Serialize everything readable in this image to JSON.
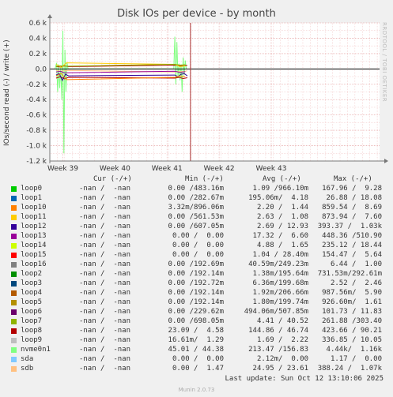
{
  "title": "Disk IOs per device - by month",
  "watermark": "RRDTOOL / TOBI OETIKER",
  "footer": {
    "last_update": "Last update: Sun Oct 12 13:10:06 2025",
    "version": "Munin 2.0.73"
  },
  "legend_headers": {
    "cur": "Cur (-/+)",
    "min": "Min (-/+)",
    "avg": "Avg (-/+)",
    "max": "Max (-/+)"
  },
  "legend_rows": [
    {
      "name": "loop0",
      "color": "#00cc00",
      "cur": "-nan /  -nan",
      "min": "0.00 /483.16m",
      "avg": "1.09 /966.10m",
      "max": "167.96 /  9.28"
    },
    {
      "name": "loop1",
      "color": "#0066b3",
      "cur": "-nan /  -nan",
      "min": "0.00 /282.67m",
      "avg": "195.06m/  4.18",
      "max": "26.88 / 18.08"
    },
    {
      "name": "loop10",
      "color": "#ff8000",
      "cur": "-nan /  -nan",
      "min": "3.32m/896.06m",
      "avg": "2.20 /  1.44",
      "max": "859.54 /  8.69"
    },
    {
      "name": "loop11",
      "color": "#ffcc00",
      "cur": "-nan /  -nan",
      "min": "0.00 /561.53m",
      "avg": "2.63 /  1.08",
      "max": "873.94 /  7.60"
    },
    {
      "name": "loop12",
      "color": "#330099",
      "cur": "-nan /  -nan",
      "min": "0.00 /607.05m",
      "avg": "2.69 / 12.93",
      "max": "393.37 /  1.03k"
    },
    {
      "name": "loop13",
      "color": "#990099",
      "cur": "-nan /  -nan",
      "min": "0.00 /  0.00",
      "avg": "17.32 /  6.60",
      "max": "448.36 /510.90"
    },
    {
      "name": "loop14",
      "color": "#ccff00",
      "cur": "-nan /  -nan",
      "min": "0.00 /  0.00",
      "avg": "4.88 /  1.65",
      "max": "235.12 / 18.44"
    },
    {
      "name": "loop15",
      "color": "#ff0000",
      "cur": "-nan /  -nan",
      "min": "0.00 /  0.00",
      "avg": "1.04 / 28.40m",
      "max": "154.47 /  5.64"
    },
    {
      "name": "loop16",
      "color": "#808080",
      "cur": "-nan /  -nan",
      "min": "0.00 /192.69m",
      "avg": "40.59m/249.23m",
      "max": "6.44 /  1.00"
    },
    {
      "name": "loop2",
      "color": "#008f00",
      "cur": "-nan /  -nan",
      "min": "0.00 /192.14m",
      "avg": "1.38m/195.64m",
      "max": "731.53m/292.61m"
    },
    {
      "name": "loop3",
      "color": "#00487d",
      "cur": "-nan /  -nan",
      "min": "0.00 /192.72m",
      "avg": "6.36m/199.68m",
      "max": "2.52 /  2.46"
    },
    {
      "name": "loop4",
      "color": "#b35a00",
      "cur": "-nan /  -nan",
      "min": "0.00 /192.14m",
      "avg": "1.92m/206.66m",
      "max": "987.56m/  5.90"
    },
    {
      "name": "loop5",
      "color": "#b38f00",
      "cur": "-nan /  -nan",
      "min": "0.00 /192.14m",
      "avg": "1.80m/199.74m",
      "max": "926.60m/  1.61"
    },
    {
      "name": "loop6",
      "color": "#6b006b",
      "cur": "-nan /  -nan",
      "min": "0.00 /229.62m",
      "avg": "494.06m/507.85m",
      "max": "101.73 / 11.83"
    },
    {
      "name": "loop7",
      "color": "#8fb300",
      "cur": "-nan /  -nan",
      "min": "0.00 /698.05m",
      "avg": "4.41 / 40.52",
      "max": "261.88 /303.40"
    },
    {
      "name": "loop8",
      "color": "#b30000",
      "cur": "-nan /  -nan",
      "min": "23.09 /  4.58",
      "avg": "144.86 / 46.74",
      "max": "423.66 / 90.21"
    },
    {
      "name": "loop9",
      "color": "#bebebe",
      "cur": "-nan /  -nan",
      "min": "16.61m/  1.29",
      "avg": "1.69 /  2.22",
      "max": "336.85 / 10.05"
    },
    {
      "name": "nvme0n1",
      "color": "#80ff80",
      "cur": "-nan /  -nan",
      "min": "45.01 / 44.38",
      "avg": "213.47 /156.83",
      "max": "4.44k/  1.16k"
    },
    {
      "name": "sda",
      "color": "#80c9ff",
      "cur": "-nan /  -nan",
      "min": "0.00 /  0.00",
      "avg": "2.12m/  0.00",
      "max": "1.17 /  0.00"
    },
    {
      "name": "sdb",
      "color": "#ffc080",
      "cur": "-nan /  -nan",
      "min": "0.00 /  1.47",
      "avg": "24.95 / 23.61",
      "max": "388.24 /  1.07k"
    }
  ],
  "chart_data": {
    "type": "line",
    "title": "Disk IOs per device - by month",
    "ylabel": "IOs/second read (-) / write (+)",
    "ylim": [
      -1200,
      600
    ],
    "yticks": [
      -1200,
      -1000,
      -800,
      -600,
      -400,
      -200,
      0,
      200,
      400,
      600
    ],
    "ytick_labels": [
      "-1.2 k",
      "-1.0 k",
      "-0.8 k",
      "-0.6 k",
      "-0.4 k",
      "-0.2 k",
      "0.0",
      "0.2 k",
      "0.4 k",
      "0.6 k"
    ],
    "xlim": [
      0,
      6.33
    ],
    "xticks": [
      0.25,
      1.25,
      2.25,
      3.25,
      4.25
    ],
    "xtick_labels": [
      "Week 39",
      "Week 40",
      "Week 41",
      "Week 42",
      "Week 43"
    ],
    "now_marker": 2.7,
    "grid": true,
    "series": [
      {
        "name": "nvme0n1",
        "color": "#80ff80",
        "x": [
          0.1,
          0.13,
          0.15,
          0.17,
          0.19,
          0.21,
          0.23,
          0.25,
          0.27,
          0.29,
          0.31,
          0.33,
          0.35,
          2.38,
          2.4,
          2.42,
          2.44,
          2.46,
          2.48,
          2.5,
          2.52,
          2.54,
          2.56,
          2.58,
          2.6,
          2.62
        ],
        "y": [
          0,
          80,
          -300,
          60,
          -250,
          20,
          -400,
          500,
          -1100,
          250,
          -300,
          90,
          0,
          0,
          420,
          -200,
          350,
          -120,
          70,
          -150,
          60,
          -300,
          150,
          -80,
          110,
          0
        ]
      },
      {
        "name": "loop8",
        "color": "#b30000",
        "x": [
          0.12,
          0.2,
          0.28,
          0.36,
          2.4,
          2.48,
          2.56,
          2.64
        ],
        "y": [
          -120,
          -100,
          -130,
          -110,
          -120,
          -110,
          -125,
          -115
        ]
      },
      {
        "name": "loop8",
        "color": "#b30000",
        "x": [
          0.12,
          0.2,
          0.28,
          0.36,
          2.4,
          2.48,
          2.56,
          2.64
        ],
        "y": [
          30,
          25,
          40,
          30,
          50,
          45,
          40,
          48
        ]
      },
      {
        "name": "loop12",
        "color": "#330099",
        "x": [
          0.12,
          0.18,
          0.24,
          0.3,
          0.36,
          2.4,
          2.46,
          2.52,
          2.58,
          2.64
        ],
        "y": [
          -80,
          -60,
          -150,
          -70,
          -90,
          -80,
          -100,
          -70,
          -60,
          -90
        ]
      },
      {
        "name": "loop10",
        "color": "#ff8000",
        "x": [
          0.12,
          0.22,
          0.32,
          2.4,
          2.5,
          2.6
        ],
        "y": [
          -90,
          -60,
          -140,
          -110,
          -90,
          -100
        ]
      },
      {
        "name": "loop11",
        "color": "#ffcc00",
        "x": [
          0.12,
          0.22,
          0.32,
          2.4,
          2.5,
          2.6
        ],
        "y": [
          60,
          20,
          80,
          60,
          30,
          40
        ]
      },
      {
        "name": "sdb",
        "color": "#ffc080",
        "x": [
          0.12,
          0.2,
          0.28,
          0.36,
          2.4,
          2.48,
          2.56,
          2.64
        ],
        "y": [
          -20,
          -30,
          -25,
          -20,
          -40,
          -30,
          -35,
          -25
        ]
      },
      {
        "name": "loop13",
        "color": "#990099",
        "x": [
          0.12,
          0.2,
          0.28,
          2.4,
          2.5,
          2.6
        ],
        "y": [
          -40,
          -30,
          -50,
          -30,
          -45,
          -35
        ]
      },
      {
        "name": "loop7",
        "color": "#8fb300",
        "x": [
          0.12,
          0.2,
          0.28,
          2.4,
          2.5,
          2.6
        ],
        "y": [
          30,
          40,
          35,
          60,
          50,
          55
        ]
      }
    ]
  }
}
